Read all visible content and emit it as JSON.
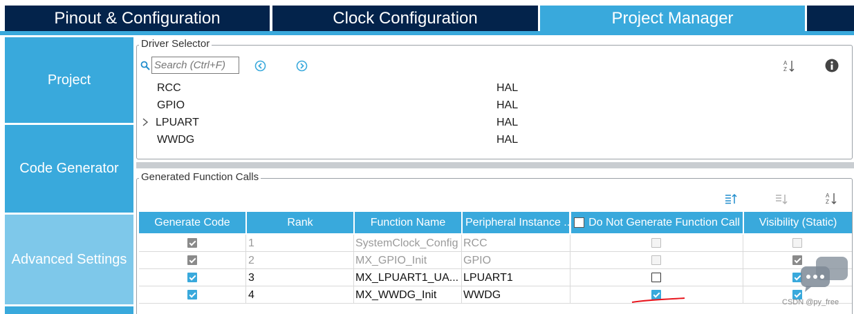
{
  "tabs": [
    {
      "label": "Pinout & Configuration",
      "active": false
    },
    {
      "label": "Clock Configuration",
      "active": false
    },
    {
      "label": "Project Manager",
      "active": true
    }
  ],
  "sidebar": {
    "items": [
      {
        "label": "Project",
        "active": false
      },
      {
        "label": "Code Generator",
        "active": false
      },
      {
        "label": "Advanced Settings",
        "active": true
      }
    ]
  },
  "driver_selector": {
    "title": "Driver Selector",
    "search_placeholder": "Search (Ctrl+F)",
    "rows": [
      {
        "name": "RCC",
        "value": "HAL",
        "expandable": false
      },
      {
        "name": "GPIO",
        "value": "HAL",
        "expandable": false
      },
      {
        "name": "LPUART",
        "value": "HAL",
        "expandable": true
      },
      {
        "name": "WWDG",
        "value": "HAL",
        "expandable": false
      }
    ]
  },
  "generated_calls": {
    "title": "Generated Function Calls",
    "columns": [
      "Generate Code",
      "Rank",
      "Function Name",
      "Peripheral Instance ...",
      "Do Not Generate Function Call",
      "Visibility (Static)"
    ],
    "rows": [
      {
        "generate": true,
        "generate_enabled": false,
        "rank": "1",
        "function": "SystemClock_Config",
        "peripheral": "RCC",
        "do_not_generate": false,
        "dng_enabled": false,
        "visibility": false,
        "vis_enabled": false,
        "dim": true
      },
      {
        "generate": true,
        "generate_enabled": false,
        "rank": "2",
        "function": "MX_GPIO_Init",
        "peripheral": "GPIO",
        "do_not_generate": false,
        "dng_enabled": false,
        "visibility": true,
        "vis_enabled": false,
        "dim": true
      },
      {
        "generate": true,
        "generate_enabled": true,
        "rank": "3",
        "function": "MX_LPUART1_UA...",
        "peripheral": "LPUART1",
        "do_not_generate": false,
        "dng_enabled": true,
        "visibility": true,
        "vis_enabled": true,
        "dim": false
      },
      {
        "generate": true,
        "generate_enabled": true,
        "rank": "4",
        "function": "MX_WWDG_Init",
        "peripheral": "WWDG",
        "do_not_generate": true,
        "dng_enabled": true,
        "visibility": true,
        "vis_enabled": true,
        "dim": false
      }
    ]
  },
  "watermark": "CSDN @py_free",
  "colors": {
    "tab_dark": "#03234b",
    "accent": "#39a9dc",
    "sidebar_active": "#7ec8ea",
    "annotation": "#e8141c"
  }
}
